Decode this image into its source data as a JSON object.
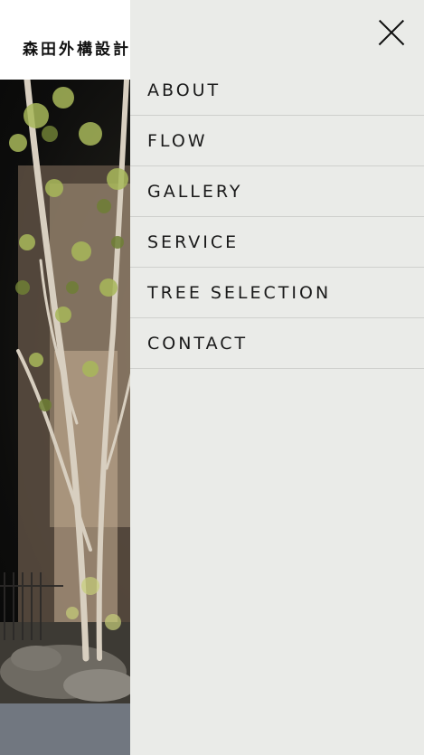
{
  "header": {
    "logo_text": "森田外構設計"
  },
  "drawer": {
    "close_icon": "close-icon",
    "menu_items": [
      {
        "label": "ABOUT"
      },
      {
        "label": "FLOW"
      },
      {
        "label": "GALLERY"
      },
      {
        "label": "SERVICE"
      },
      {
        "label": "TREE SELECTION"
      },
      {
        "label": "CONTACT"
      }
    ]
  },
  "colors": {
    "drawer_bg": "#eaebe8",
    "divider": "#cfd0cd",
    "text": "#1a1a1a"
  }
}
